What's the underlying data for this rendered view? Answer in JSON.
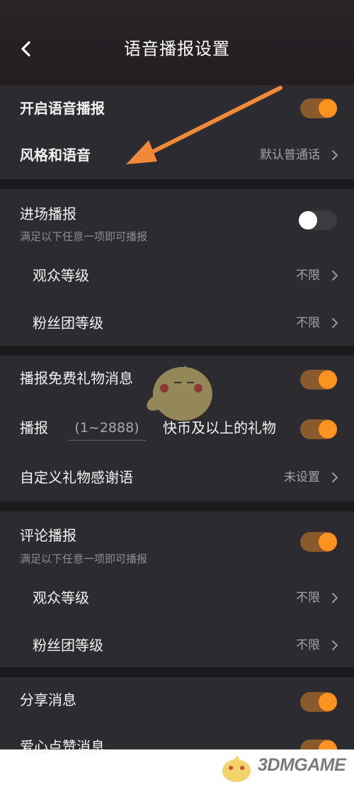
{
  "header": {
    "title": "语音播报设置",
    "back_icon": "chevron-left-icon"
  },
  "broadcast": {
    "enable_label": "开启语音播报",
    "enable_on": true,
    "style_label": "风格和语音",
    "style_value": "默认普通话"
  },
  "entry": {
    "label": "进场播报",
    "sub": "满足以下任意一项即可播报",
    "on": false,
    "audience_label": "观众等级",
    "audience_value": "不限",
    "fan_label": "粉丝团等级",
    "fan_value": "不限"
  },
  "gift": {
    "free_label": "播报免费礼物消息",
    "free_on": true,
    "prefix": "播报",
    "placeholder": "(1~2888)",
    "suffix": "快币及以上的礼物",
    "threshold_on": true,
    "thanks_label": "自定义礼物感谢语",
    "thanks_value": "未设置"
  },
  "comment": {
    "label": "评论播报",
    "sub": "满足以下任意一项即可播报",
    "on": true,
    "audience_label": "观众等级",
    "audience_value": "不限",
    "fan_label": "粉丝团等级",
    "fan_value": "不限"
  },
  "share": {
    "label": "分享消息",
    "on": true
  },
  "like": {
    "label": "爱心点赞消息",
    "on": true
  },
  "overlay": {
    "arrow_color": "#f08a3a"
  },
  "watermark": {
    "text": "3DMGAME"
  },
  "colors": {
    "accent": "#ff9320",
    "background": "#1a1a1c",
    "card": "#2c2b2f"
  }
}
